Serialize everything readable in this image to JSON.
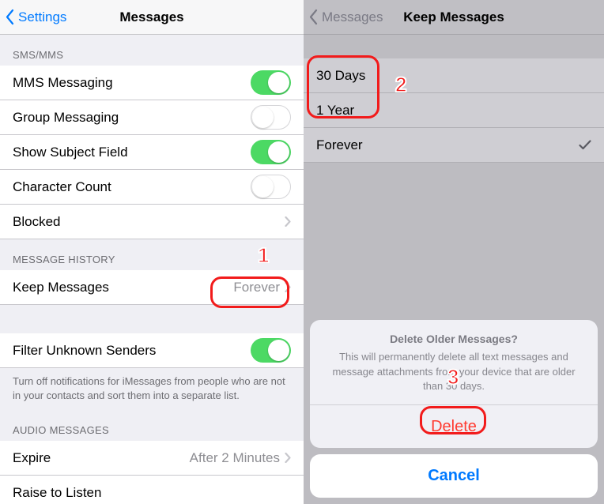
{
  "left": {
    "nav": {
      "back": "Settings",
      "title": "Messages"
    },
    "sections": {
      "smsmms": {
        "header": "SMS/MMS",
        "rows": {
          "mms": {
            "label": "MMS Messaging",
            "on": true
          },
          "group": {
            "label": "Group Messaging",
            "on": false
          },
          "subj": {
            "label": "Show Subject Field",
            "on": true
          },
          "cc": {
            "label": "Character Count",
            "on": false
          },
          "blocked": {
            "label": "Blocked"
          }
        }
      },
      "history": {
        "header": "MESSAGE HISTORY",
        "keep": {
          "label": "Keep Messages",
          "value": "Forever"
        }
      },
      "filter": {
        "row": {
          "label": "Filter Unknown Senders",
          "on": true
        },
        "footer": "Turn off notifications for iMessages from people who are not in your contacts and sort them into a separate list."
      },
      "audio": {
        "header": "AUDIO MESSAGES",
        "expire": {
          "label": "Expire",
          "value": "After 2 Minutes"
        },
        "raise": {
          "label": "Raise to Listen"
        }
      }
    }
  },
  "right": {
    "nav": {
      "back": "Messages",
      "title": "Keep Messages"
    },
    "options": {
      "o0": {
        "label": "30 Days",
        "selected": false
      },
      "o1": {
        "label": "1 Year",
        "selected": false
      },
      "o2": {
        "label": "Forever",
        "selected": true
      }
    },
    "sheet": {
      "title": "Delete Older Messages?",
      "message": "This will permanently delete all text messages and message attachments from your device that are older than 30 days.",
      "destructive": "Delete",
      "cancel": "Cancel"
    }
  },
  "annotations": {
    "n1": "1",
    "n2": "2",
    "n3": "3"
  }
}
